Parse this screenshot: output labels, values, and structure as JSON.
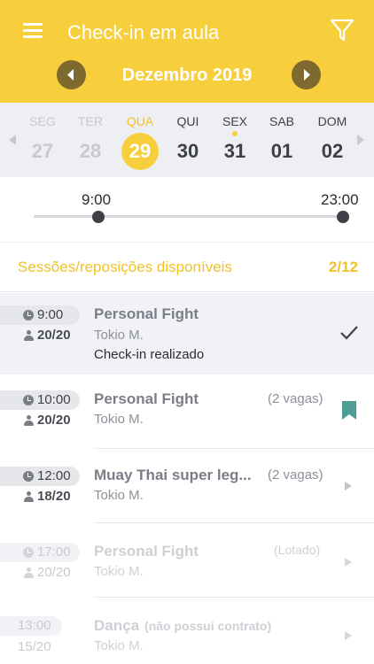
{
  "header": {
    "title": "Check-in em aula",
    "month": "Dezembro 2019",
    "accent": "#f7cf3d"
  },
  "week": {
    "days": [
      {
        "dow": "SEG",
        "num": "27"
      },
      {
        "dow": "TER",
        "num": "28"
      },
      {
        "dow": "QUA",
        "num": "29"
      },
      {
        "dow": "QUI",
        "num": "30"
      },
      {
        "dow": "SEX",
        "num": "31"
      },
      {
        "dow": "SAB",
        "num": "01"
      },
      {
        "dow": "DOM",
        "num": "02"
      }
    ]
  },
  "slider": {
    "start": "9:00",
    "end": "23:00"
  },
  "sessions": {
    "label": "Sessões/reposições disponíveis",
    "count": "2/12"
  },
  "rows": [
    {
      "time": "9:00",
      "capacity": "20/20",
      "name": "Personal Fight",
      "teacher": "Tokio M.",
      "status": "Check-in realizado"
    },
    {
      "time": "10:00",
      "capacity": "20/20",
      "name": "Personal Fight",
      "teacher": "Tokio M.",
      "vagas": "(2 vagas)"
    },
    {
      "time": "12:00",
      "capacity": "18/20",
      "name": "Muay Thai super leg...",
      "teacher": "Tokio M.",
      "vagas": "(2 vagas)"
    },
    {
      "time": "17:00",
      "capacity": "20/20",
      "name": "Personal Fight",
      "teacher": "Tokio M.",
      "vagas": "(Lotado)"
    },
    {
      "time": "13:00",
      "capacity": "15/20",
      "name": "Dança",
      "note": "(não possui contrato)",
      "teacher": "Tokio M."
    }
  ]
}
